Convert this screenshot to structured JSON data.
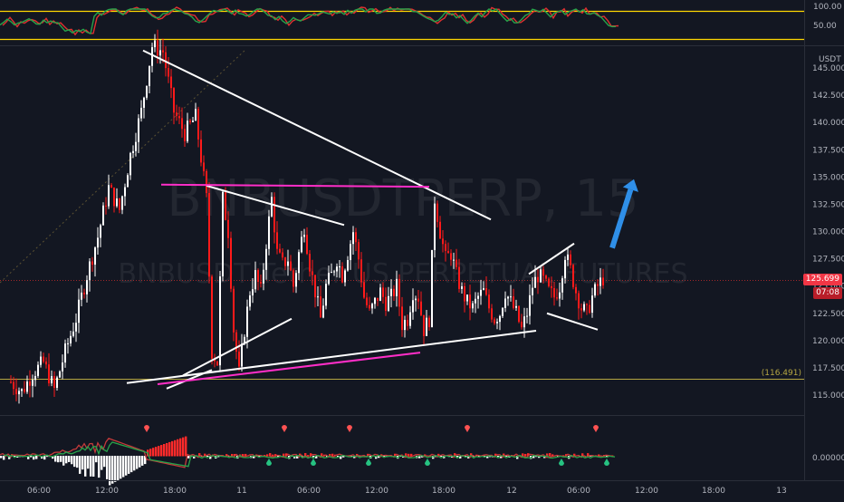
{
  "symbol": {
    "watermark_ticker": "BNBUSDTPERP, 15",
    "watermark_desc": "BNBUSDT Tether US PERPETUAL FUTURES"
  },
  "rsi_axis": {
    "labels": [
      "100.00",
      "50.00"
    ]
  },
  "price_axis": {
    "currency": "USDT",
    "labels": [
      "145.000",
      "142.500",
      "140.000",
      "137.500",
      "135.000",
      "132.500",
      "130.000",
      "127.500",
      "125.000",
      "122.500",
      "120.000",
      "117.500",
      "115.000"
    ],
    "last_price": "125.699",
    "countdown": "07:08",
    "support_label": "(116.491)"
  },
  "macd_axis": {
    "labels": [
      "0.000000"
    ]
  },
  "time_axis": {
    "labels": [
      "06:00",
      "12:00",
      "18:00",
      "11",
      "06:00",
      "12:00",
      "18:00",
      "12",
      "06:00",
      "12:00",
      "18:00",
      "13"
    ]
  },
  "colors": {
    "up": "#ffffff",
    "down": "#ff1a1a",
    "support": "#b5a642",
    "arrow": "#2f8fe8",
    "magenta": "#ff2ec8",
    "rsi_band": "#ffd700"
  },
  "chart_data": {
    "type": "candlestick",
    "symbol": "BNBUSDTPERP",
    "timeframe": "15",
    "ylim": [
      113.2,
      148.0
    ],
    "y_ticks": [
      115,
      117.5,
      120,
      122.5,
      125,
      127.5,
      130,
      132.5,
      135,
      137.5,
      140,
      142.5,
      145
    ],
    "last_price": 125.699,
    "support_level": 116.491,
    "price_path": [
      [
        0,
        116.2
      ],
      [
        4,
        115.3
      ],
      [
        8,
        117.0
      ],
      [
        12,
        118.0
      ],
      [
        16,
        115.5
      ],
      [
        20,
        119.0
      ],
      [
        24,
        122.0
      ],
      [
        28,
        126.0
      ],
      [
        32,
        129.5
      ],
      [
        36,
        134.0
      ],
      [
        40,
        132.0
      ],
      [
        44,
        137.0
      ],
      [
        48,
        141.0
      ],
      [
        52,
        147.0
      ],
      [
        56,
        146.5
      ],
      [
        60,
        141.0
      ],
      [
        64,
        139.0
      ],
      [
        68,
        140.5
      ],
      [
        72,
        133.0
      ],
      [
        74,
        119.0
      ],
      [
        76,
        118.0
      ],
      [
        78,
        133.0
      ],
      [
        80,
        130.0
      ],
      [
        82,
        121.0
      ],
      [
        84,
        117.0
      ],
      [
        86,
        121.0
      ],
      [
        88,
        124.5
      ],
      [
        90,
        126.0
      ],
      [
        92,
        124.5
      ],
      [
        94,
        129.0
      ],
      [
        96,
        133.0
      ],
      [
        98,
        128.0
      ],
      [
        100,
        127.0
      ],
      [
        102,
        127.5
      ],
      [
        104,
        125.0
      ],
      [
        106,
        128.0
      ],
      [
        108,
        130.5
      ],
      [
        110,
        127.0
      ],
      [
        112,
        124.5
      ],
      [
        114,
        122.0
      ],
      [
        116,
        125.0
      ],
      [
        118,
        126.0
      ],
      [
        120,
        127.5
      ],
      [
        122,
        126.0
      ],
      [
        124,
        128.0
      ],
      [
        126,
        130.0
      ],
      [
        128,
        127.5
      ],
      [
        130,
        124.0
      ],
      [
        132,
        122.5
      ],
      [
        134,
        123.5
      ],
      [
        136,
        124.5
      ],
      [
        138,
        123.5
      ],
      [
        140,
        124.0
      ],
      [
        142,
        125.0
      ],
      [
        144,
        121.5
      ],
      [
        146,
        122.0
      ],
      [
        148,
        124.5
      ],
      [
        150,
        124.0
      ],
      [
        152,
        121.0
      ],
      [
        154,
        122.0
      ],
      [
        156,
        133.0
      ],
      [
        158,
        130.0
      ],
      [
        160,
        127.5
      ],
      [
        162,
        128.0
      ],
      [
        164,
        126.0
      ],
      [
        166,
        124.5
      ],
      [
        168,
        123.5
      ],
      [
        170,
        123.0
      ],
      [
        172,
        124.0
      ],
      [
        174,
        124.5
      ],
      [
        176,
        123.0
      ],
      [
        178,
        122.0
      ],
      [
        180,
        122.5
      ],
      [
        182,
        124.5
      ],
      [
        184,
        123.5
      ],
      [
        186,
        122.5
      ],
      [
        188,
        121.0
      ],
      [
        190,
        122.5
      ],
      [
        192,
        125.0
      ],
      [
        194,
        126.0
      ],
      [
        196,
        125.5
      ],
      [
        198,
        124.5
      ],
      [
        200,
        124.0
      ],
      [
        202,
        125.0
      ],
      [
        204,
        128.0
      ],
      [
        206,
        126.5
      ],
      [
        208,
        124.5
      ],
      [
        210,
        123.0
      ],
      [
        212,
        122.5
      ],
      [
        214,
        124.0
      ],
      [
        216,
        125.0
      ],
      [
        218,
        125.699
      ]
    ],
    "drawings": [
      {
        "kind": "trendline",
        "color": "white",
        "from": [
          158.0,
          146.6
        ],
        "to": [
          542.0,
          131.1
        ]
      },
      {
        "kind": "trendline",
        "color": "white",
        "from": [
          228.0,
          134.2
        ],
        "to": [
          380.0,
          130.6
        ]
      },
      {
        "kind": "trendline",
        "color": "white",
        "from": [
          202.0,
          116.8
        ],
        "to": [
          322.0,
          122.0
        ]
      },
      {
        "kind": "trendline",
        "color": "white",
        "from": [
          140.0,
          116.1
        ],
        "to": [
          592.0,
          120.9
        ]
      },
      {
        "kind": "trendline",
        "color": "white",
        "from": [
          184.0,
          115.6
        ],
        "to": [
          234.0,
          117.3
        ]
      },
      {
        "kind": "trendline",
        "color": "white",
        "from": [
          584.0,
          126.1
        ],
        "to": [
          634.0,
          128.9
        ]
      },
      {
        "kind": "trendline",
        "color": "white",
        "from": [
          604.0,
          122.5
        ],
        "to": [
          660.0,
          121.0
        ]
      },
      {
        "kind": "trendline",
        "color": "magenta",
        "from": [
          178.0,
          134.3
        ],
        "to": [
          474.0,
          134.1
        ]
      },
      {
        "kind": "trendline",
        "color": "magenta",
        "from": [
          174.0,
          116.0
        ],
        "to": [
          464.0,
          118.9
        ]
      },
      {
        "kind": "arrow",
        "color": "blue",
        "from": [
          676.0,
          128.5
        ],
        "to": [
          700.0,
          134.8
        ]
      }
    ]
  }
}
